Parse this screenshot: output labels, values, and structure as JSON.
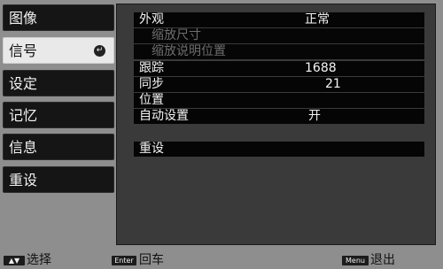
{
  "menu": [
    {
      "label": "图像"
    },
    {
      "label": "信号",
      "selected": true
    },
    {
      "label": "设定"
    },
    {
      "label": "记忆"
    },
    {
      "label": "信息"
    },
    {
      "label": "重设"
    }
  ],
  "panel": {
    "rows": [
      {
        "label": "外观",
        "value": "正常"
      },
      {
        "label": "缩放尺寸",
        "value": "",
        "disabled": true
      },
      {
        "label": "缩放说明位置",
        "value": "",
        "disabled": true
      },
      {
        "label": "跟踪",
        "value": "1688"
      },
      {
        "label": "同步",
        "value": "21"
      },
      {
        "label": "位置",
        "value": ""
      },
      {
        "label": "自动设置",
        "value": "开"
      }
    ],
    "reset_label": "重设"
  },
  "footer": {
    "select_key": "▲▼",
    "select_label": "选择",
    "enter_key": "Enter",
    "enter_label": "回车",
    "menu_key": "Menu",
    "menu_label": "退出"
  }
}
